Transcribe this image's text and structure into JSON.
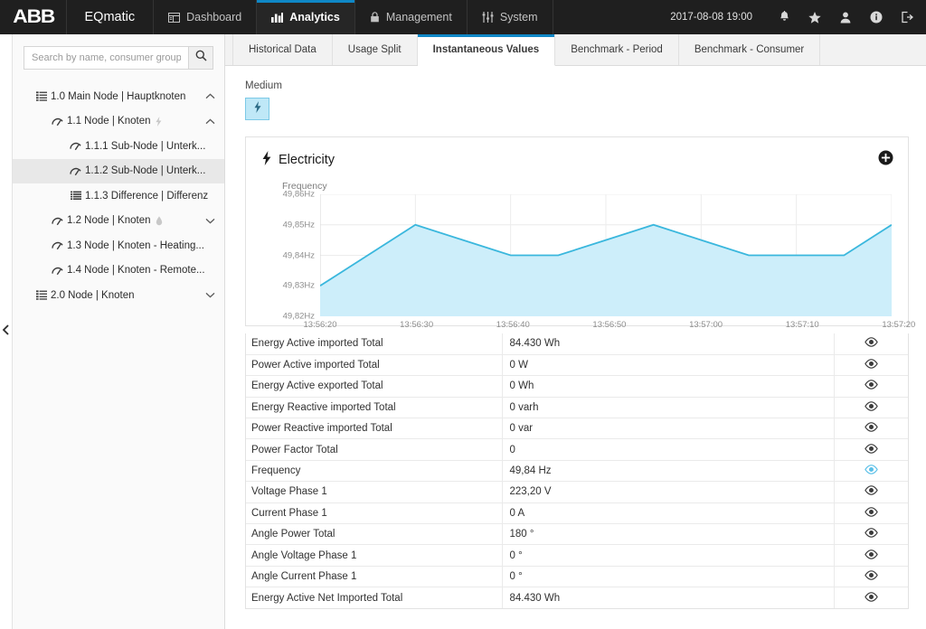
{
  "topbar": {
    "logo": "ABB",
    "product": "EQmatic",
    "nav": [
      {
        "label": "Dashboard",
        "icon": "dashboard-icon",
        "active": false
      },
      {
        "label": "Analytics",
        "icon": "analytics-icon",
        "active": true
      },
      {
        "label": "Management",
        "icon": "lock-icon",
        "active": false
      },
      {
        "label": "System",
        "icon": "sliders-icon",
        "active": false
      }
    ],
    "clock": "2017-08-08 19:00",
    "icons": [
      "bell-icon",
      "star-icon",
      "user-icon",
      "info-icon",
      "logout-icon"
    ]
  },
  "sidebar": {
    "search": {
      "placeholder": "Search by name, consumer group, me!",
      "value": "",
      "button_icon": "search-icon"
    },
    "tree": [
      {
        "label": "1.0 Main Node | Hauptknoten",
        "icon": "group-icon",
        "level": 0,
        "chevron": "up",
        "selected": false,
        "suffix": ""
      },
      {
        "label": "1.1 Node | Knoten",
        "icon": "meter-icon",
        "level": 1,
        "chevron": "up",
        "selected": false,
        "suffix": "bolt-icon"
      },
      {
        "label": "1.1.1 Sub-Node | Unterk...",
        "icon": "meter-icon",
        "level": 2,
        "chevron": "",
        "selected": false,
        "suffix": ""
      },
      {
        "label": "1.1.2 Sub-Node | Unterk...",
        "icon": "meter-icon",
        "level": 2,
        "chevron": "",
        "selected": true,
        "suffix": ""
      },
      {
        "label": "1.1.3 Difference | Differenz",
        "icon": "difference-icon",
        "level": 2,
        "chevron": "",
        "selected": false,
        "suffix": ""
      },
      {
        "label": "1.2 Node | Knoten",
        "icon": "meter-icon",
        "level": 1,
        "chevron": "down",
        "selected": false,
        "suffix": "drop-icon"
      },
      {
        "label": "1.3 Node | Knoten - Heating...",
        "icon": "meter-icon",
        "level": 1,
        "chevron": "",
        "selected": false,
        "suffix": ""
      },
      {
        "label": "1.4 Node | Knoten - Remote...",
        "icon": "meter-icon",
        "level": 1,
        "chevron": "",
        "selected": false,
        "suffix": ""
      },
      {
        "label": "2.0 Node | Knoten",
        "icon": "group-icon",
        "level": 0,
        "chevron": "down",
        "selected": false,
        "suffix": ""
      }
    ],
    "collapse_icon": "chevron-left-icon"
  },
  "tabs": [
    {
      "label": "Historical Data",
      "active": false
    },
    {
      "label": "Usage Split",
      "active": false
    },
    {
      "label": "Instantaneous Values",
      "active": true
    },
    {
      "label": "Benchmark - Period",
      "active": false
    },
    {
      "label": "Benchmark - Consumer",
      "active": false
    }
  ],
  "medium": {
    "label": "Medium",
    "button_icon": "bolt-icon",
    "selected": true
  },
  "panel": {
    "title": "Electricity",
    "title_icon": "bolt-icon",
    "add_icon": "plus-circle-icon"
  },
  "chart_data": {
    "type": "area",
    "title": "Electricity",
    "xlabel": "",
    "ylabel": "Frequency",
    "ylim": [
      49.82,
      49.86
    ],
    "yticks": [
      "49,82Hz",
      "49,83Hz",
      "49,84Hz",
      "49,85Hz",
      "49,86Hz"
    ],
    "ytick_values": [
      49.82,
      49.83,
      49.84,
      49.85,
      49.86
    ],
    "xticks": [
      "13:56:20",
      "13:56:30",
      "13:56:40",
      "13:56:50",
      "13:57:00",
      "13:57:10",
      "13:57:20"
    ],
    "grid": true,
    "legend": "none",
    "series": [
      {
        "name": "Frequency",
        "unit": "Hz",
        "color": "#3ab7dd",
        "fill": "#cdeefa",
        "x": [
          "13:56:20",
          "13:56:25",
          "13:56:30",
          "13:56:35",
          "13:56:40",
          "13:56:45",
          "13:56:50",
          "13:56:55",
          "13:57:00",
          "13:57:05",
          "13:57:10",
          "13:57:15",
          "13:57:20"
        ],
        "values": [
          49.83,
          49.84,
          49.85,
          49.845,
          49.84,
          49.84,
          49.845,
          49.85,
          49.845,
          49.84,
          49.84,
          49.84,
          49.85
        ]
      }
    ]
  },
  "table": {
    "eye_icon": "eye-icon",
    "eye_active_icon": "eye-active-icon",
    "rows": [
      {
        "name": "Energy Active imported Total",
        "value": "84.430 Wh",
        "visible": false
      },
      {
        "name": "Power Active imported Total",
        "value": "0 W",
        "visible": false
      },
      {
        "name": "Energy Active exported Total",
        "value": "0 Wh",
        "visible": false
      },
      {
        "name": "Energy Reactive imported Total",
        "value": "0 varh",
        "visible": false
      },
      {
        "name": "Power Reactive imported Total",
        "value": "0 var",
        "visible": false
      },
      {
        "name": "Power Factor Total",
        "value": "0",
        "visible": false
      },
      {
        "name": "Frequency",
        "value": "49,84 Hz",
        "visible": true
      },
      {
        "name": "Voltage Phase 1",
        "value": "223,20 V",
        "visible": false
      },
      {
        "name": "Current Phase 1",
        "value": "0 A",
        "visible": false
      },
      {
        "name": "Angle Power Total",
        "value": "180 °",
        "visible": false
      },
      {
        "name": "Angle Voltage Phase 1",
        "value": "0 °",
        "visible": false
      },
      {
        "name": "Angle Current Phase 1",
        "value": "0 °",
        "visible": false
      },
      {
        "name": "Energy Active Net Imported Total",
        "value": "84.430 Wh",
        "visible": false
      }
    ]
  },
  "colors": {
    "accent": "#0f87c6",
    "topbar": "#1f1f1f",
    "chart_line": "#3ab7dd",
    "chart_fill": "#cdeefa",
    "medium_btn": "#bfe8f7"
  }
}
